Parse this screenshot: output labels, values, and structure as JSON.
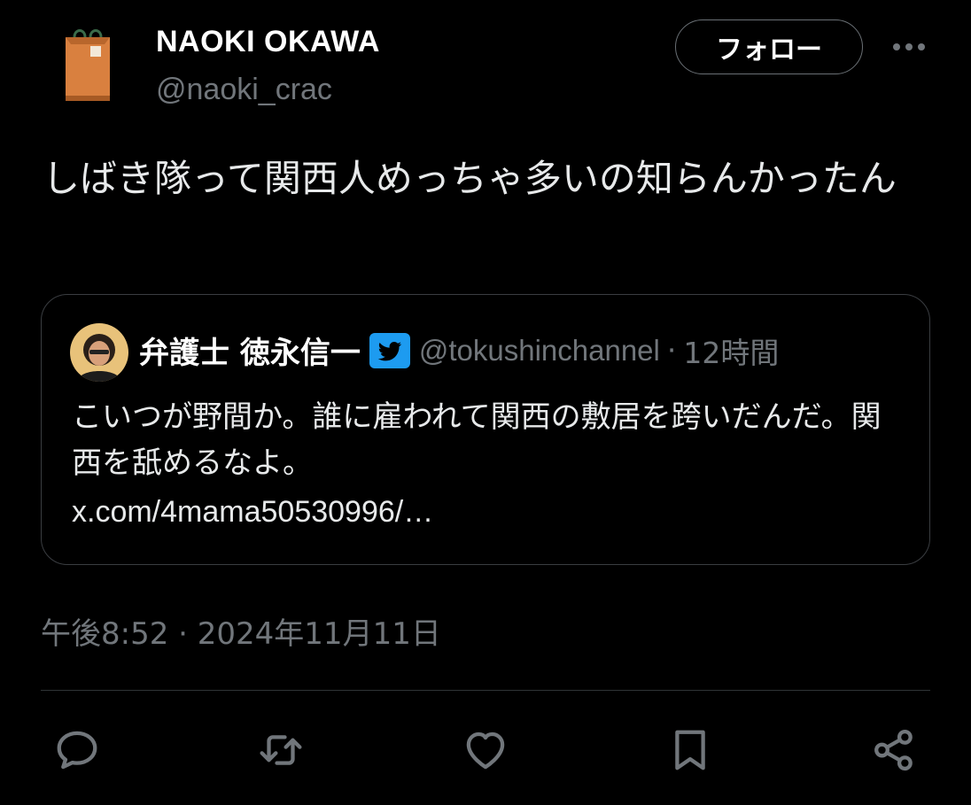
{
  "tweet": {
    "author": {
      "name": "NAOKI OKAWA",
      "handle": "@naoki_crac",
      "avatar_icon": "paper-bag-icon"
    },
    "follow_label": "フォロー",
    "more_icon": "more-options-icon",
    "text": "しばき隊って関西人めっちゃ多いの知らんかったん",
    "timestamp": "午後8:52 · 2024年11月11日"
  },
  "quoted": {
    "name": "弁護士 徳永信一",
    "badge_icon": "twitter-bird-verified-icon",
    "handle": "@tokushinchannel",
    "separator": "·",
    "time": "12時間",
    "text": "こいつが野間か。誰に雇われて関西の敷居を跨いだんだ。関西を舐めるなよ。",
    "link": "x.com/4mama50530996/…"
  },
  "actions": [
    {
      "name": "reply",
      "icon": "reply-icon"
    },
    {
      "name": "retweet",
      "icon": "retweet-icon"
    },
    {
      "name": "like",
      "icon": "heart-icon"
    },
    {
      "name": "bookmark",
      "icon": "bookmark-icon"
    },
    {
      "name": "share",
      "icon": "share-icon"
    }
  ],
  "colors": {
    "background": "#000000",
    "text": "#e7e9ea",
    "secondary": "#71767b",
    "border": "#2f3336",
    "badge": "#1d9bf0"
  }
}
